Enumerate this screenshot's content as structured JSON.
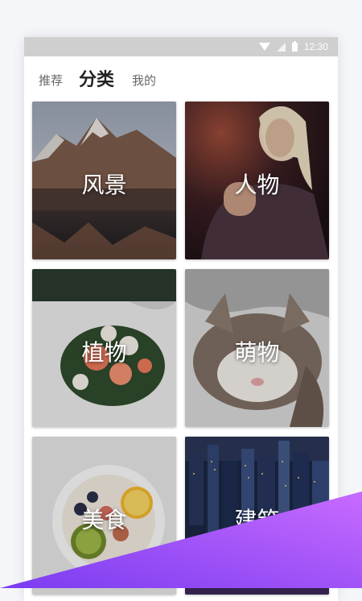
{
  "status_bar": {
    "time": "12:30",
    "icons": [
      "wifi-icon",
      "signal-icon",
      "battery-icon"
    ]
  },
  "tabs": [
    {
      "label": "推荐",
      "active": false
    },
    {
      "label": "分类",
      "active": true
    },
    {
      "label": "我的",
      "active": false
    }
  ],
  "categories": [
    {
      "label": "风景",
      "image": "mountain-lake-photo"
    },
    {
      "label": "人物",
      "image": "portrait-woman-photo"
    },
    {
      "label": "植物",
      "image": "flower-bouquet-photo"
    },
    {
      "label": "萌物",
      "image": "sleeping-cat-photo"
    },
    {
      "label": "美食",
      "image": "fruit-bowl-photo"
    },
    {
      "label": "建筑",
      "image": "city-night-photo"
    }
  ],
  "colors": {
    "status_bar": "#cfcfcf",
    "accent_gradient_start": "#7a3cf0",
    "accent_gradient_end": "#c86bff",
    "tab_active": "#222222",
    "tab_inactive": "#666666"
  }
}
